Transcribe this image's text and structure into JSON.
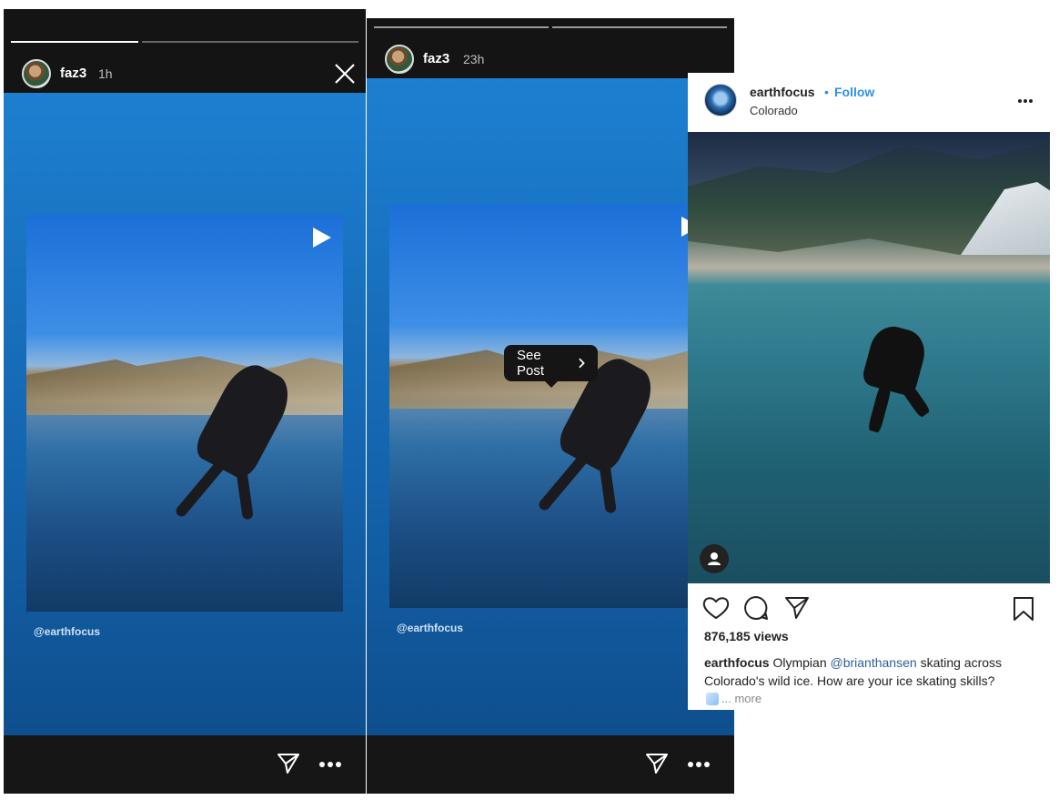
{
  "stories": [
    {
      "username": "faz3",
      "time": "1h",
      "credit": "@earthfocus",
      "progress": [
        0.55,
        0.0
      ]
    },
    {
      "username": "faz3",
      "time": "23h",
      "credit": "@earthfocus",
      "progress": [
        1.0,
        1.0
      ],
      "see_post_label": "See Post"
    }
  ],
  "post": {
    "username": "earthfocus",
    "follow_label": "Follow",
    "separator": "•",
    "location": "Colorado",
    "views": "876,185 views",
    "caption_user": "earthfocus",
    "caption_before": "Olympian",
    "caption_mention": "@brianthansen",
    "caption_after": "skating across Colorado's wild ice. How are your ice skating skills?",
    "more_label": "... more"
  }
}
